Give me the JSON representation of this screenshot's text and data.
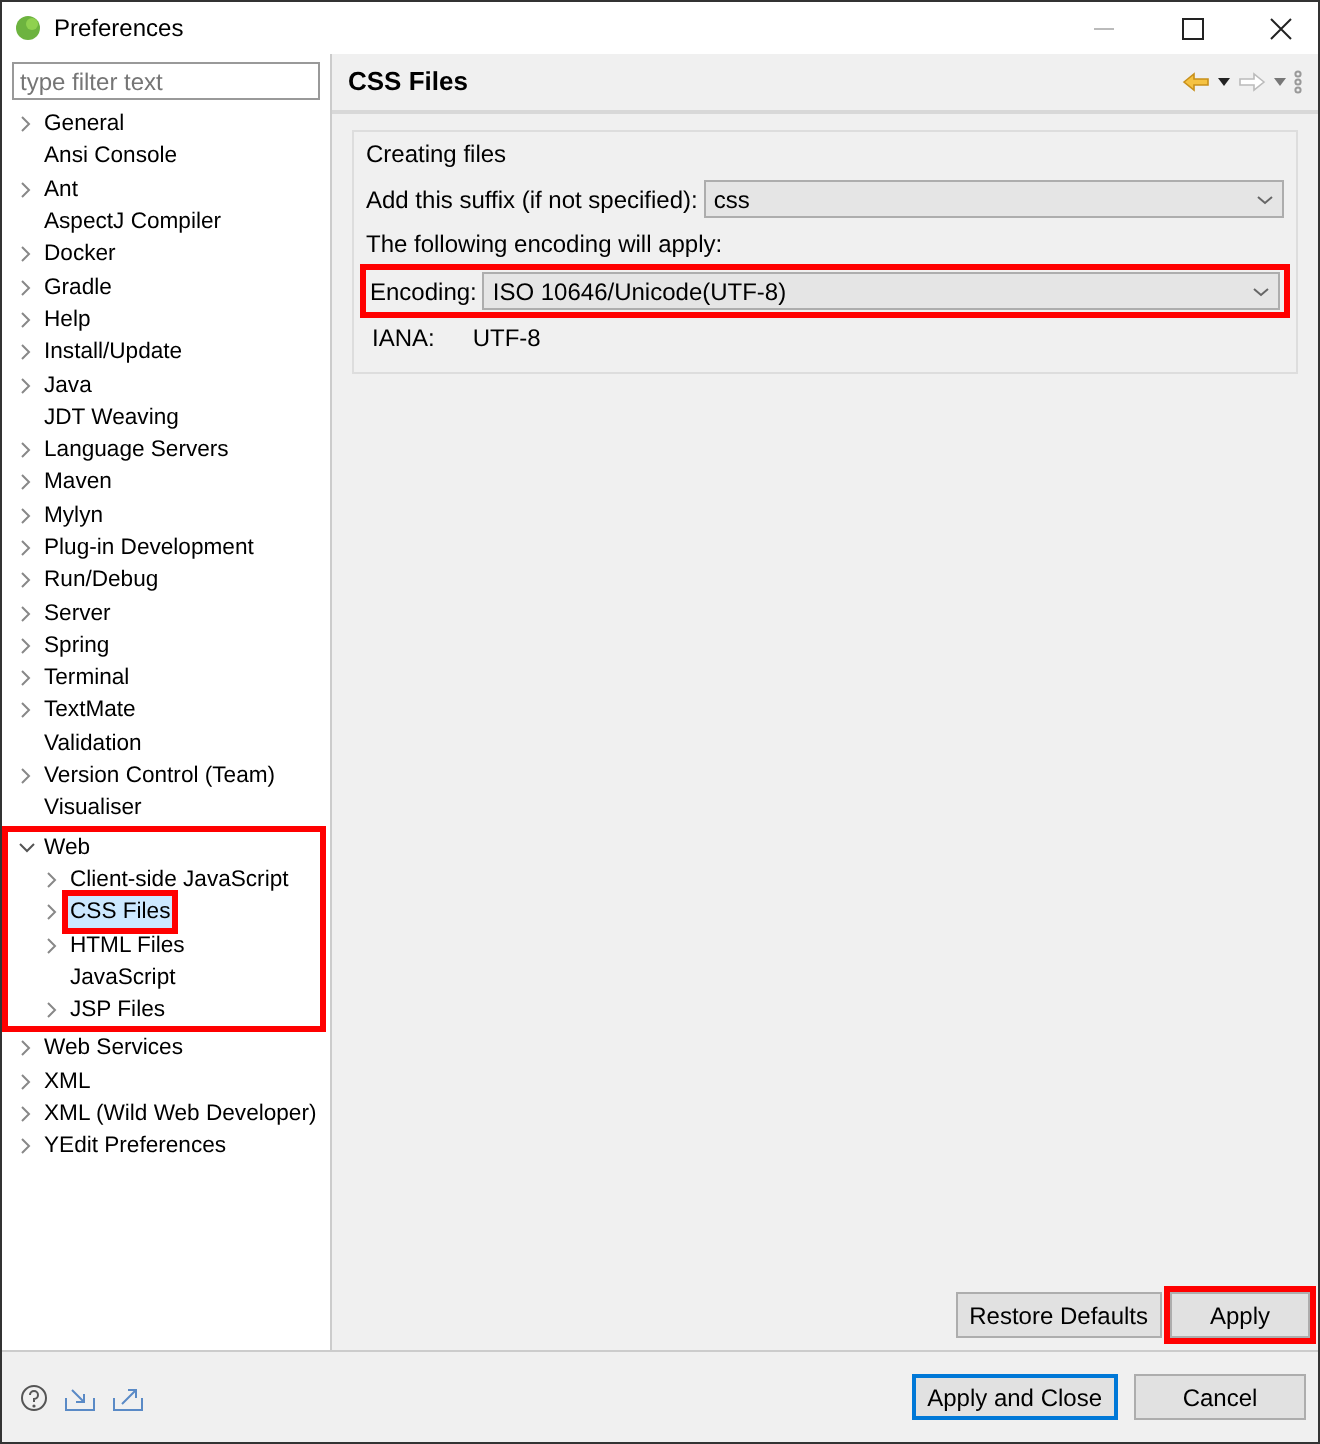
{
  "window": {
    "title": "Preferences"
  },
  "filter": {
    "placeholder": "type filter text"
  },
  "tree": [
    {
      "label": "General",
      "expandable": true,
      "expanded": false
    },
    {
      "label": "Ansi Console",
      "expandable": false
    },
    {
      "label": "Ant",
      "expandable": true,
      "expanded": false
    },
    {
      "label": "AspectJ Compiler",
      "expandable": false
    },
    {
      "label": "Docker",
      "expandable": true,
      "expanded": false
    },
    {
      "label": "Gradle",
      "expandable": true,
      "expanded": false
    },
    {
      "label": "Help",
      "expandable": true,
      "expanded": false
    },
    {
      "label": "Install/Update",
      "expandable": true,
      "expanded": false
    },
    {
      "label": "Java",
      "expandable": true,
      "expanded": false
    },
    {
      "label": "JDT Weaving",
      "expandable": false
    },
    {
      "label": "Language Servers",
      "expandable": true,
      "expanded": false
    },
    {
      "label": "Maven",
      "expandable": true,
      "expanded": false
    },
    {
      "label": "Mylyn",
      "expandable": true,
      "expanded": false
    },
    {
      "label": "Plug-in Development",
      "expandable": true,
      "expanded": false
    },
    {
      "label": "Run/Debug",
      "expandable": true,
      "expanded": false
    },
    {
      "label": "Server",
      "expandable": true,
      "expanded": false
    },
    {
      "label": "Spring",
      "expandable": true,
      "expanded": false
    },
    {
      "label": "Terminal",
      "expandable": true,
      "expanded": false
    },
    {
      "label": "TextMate",
      "expandable": true,
      "expanded": false
    },
    {
      "label": "Validation",
      "expandable": false
    },
    {
      "label": "Version Control (Team)",
      "expandable": true,
      "expanded": false
    },
    {
      "label": "Visualiser",
      "expandable": false
    },
    {
      "label": "Web",
      "expandable": true,
      "expanded": true,
      "highlighted": true,
      "children": [
        {
          "label": "Client-side JavaScript",
          "expandable": true,
          "expanded": false
        },
        {
          "label": "CSS Files",
          "expandable": true,
          "expanded": false,
          "selected": true,
          "highlighted": true
        },
        {
          "label": "HTML Files",
          "expandable": true,
          "expanded": false
        },
        {
          "label": "JavaScript",
          "expandable": false
        },
        {
          "label": "JSP Files",
          "expandable": true,
          "expanded": false
        }
      ]
    },
    {
      "label": "Web Services",
      "expandable": true,
      "expanded": false
    },
    {
      "label": "XML",
      "expandable": true,
      "expanded": false
    },
    {
      "label": "XML (Wild Web Developer)",
      "expandable": true,
      "expanded": false
    },
    {
      "label": "YEdit Preferences",
      "expandable": true,
      "expanded": false
    }
  ],
  "page": {
    "title": "CSS Files",
    "group": {
      "title": "Creating files",
      "suffix": {
        "label": "Add this suffix (if not specified):",
        "value": "css"
      },
      "note": "The following encoding will apply:",
      "encoding": {
        "label": "Encoding:",
        "value": "ISO 10646/Unicode(UTF-8)",
        "highlighted": true
      },
      "iana": {
        "label": "IANA:",
        "value": "UTF-8"
      }
    },
    "buttons": [
      {
        "label": "Restore Defaults",
        "highlighted": false
      },
      {
        "label": "Apply",
        "highlighted": true
      }
    ]
  },
  "footer": {
    "buttons": [
      {
        "label": "Apply and Close",
        "default": true
      },
      {
        "label": "Cancel",
        "default": false
      }
    ]
  }
}
